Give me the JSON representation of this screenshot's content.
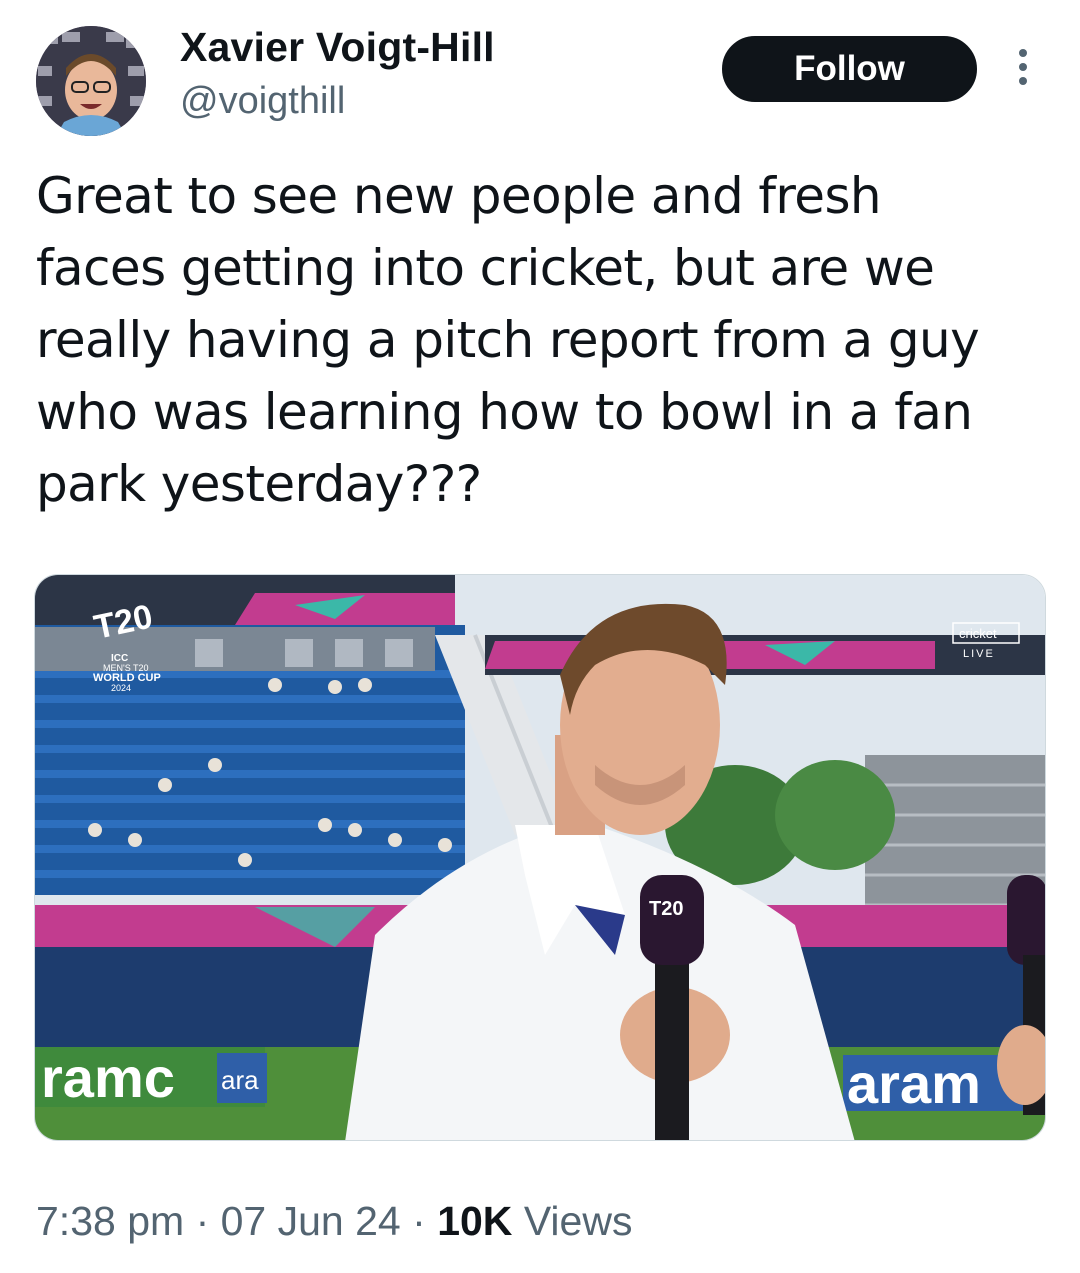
{
  "author": {
    "name": "Xavier Voigt-Hill",
    "handle": "@voigthill"
  },
  "actions": {
    "follow_label": "Follow",
    "more_icon": "more-vertical-icon"
  },
  "tweet": {
    "text": "Great to see new people and fresh\nfaces getting into cricket, but are we\nreally having a pitch report from a guy\nwho was learning how to bowl in a fan\npark yesterday???"
  },
  "media": {
    "logo_t20": "T20",
    "logo_line1": "ICC",
    "logo_line2": "MEN'S T20",
    "logo_line3": "WORLD CUP",
    "logo_year": "2024",
    "broadcaster": "cricket",
    "live_label": "LIVE",
    "sponsor_left": "ramc",
    "sponsor_left_small": "ara",
    "sponsor_right": "aram"
  },
  "meta": {
    "time": "7:38 pm",
    "separator": "·",
    "date": "07 Jun 24",
    "views_count": "10K",
    "views_label": "Views"
  },
  "colors": {
    "text": "#0f1419",
    "secondary": "#536471",
    "button_bg": "#0f1419"
  }
}
